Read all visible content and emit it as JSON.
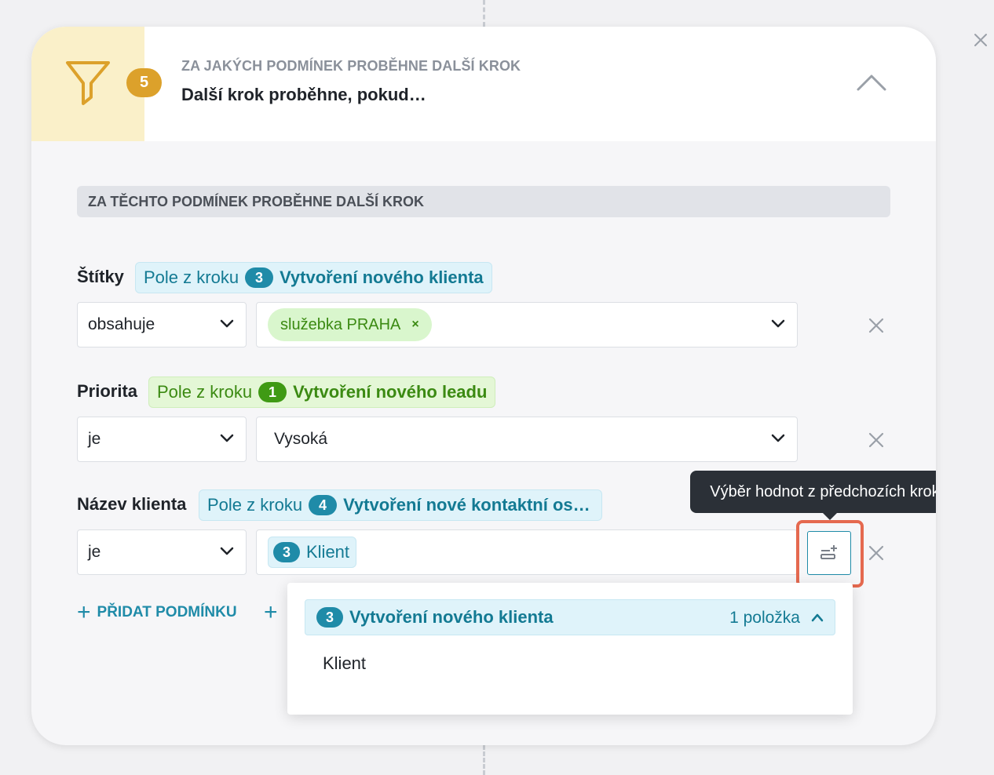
{
  "header": {
    "step_number": "5",
    "overline": "ZA JAKÝCH PODMÍNEK PROBĚHNE DALŠÍ KROK",
    "title": "Další krok proběhne, pokud…"
  },
  "section": {
    "title": "ZA TĚCHTO PODMÍNEK PROBĚHNE DALŠÍ KROK"
  },
  "conditions": [
    {
      "label": "Štítky",
      "field_prefix": "Pole z kroku",
      "step_number": "3",
      "step_name": "Vytvoření nového klienta",
      "operator": "obsahuje",
      "value_tag": "služebka PRAHA",
      "value_tag_remove": "×"
    },
    {
      "label": "Priorita",
      "field_prefix": "Pole z kroku",
      "step_number": "1",
      "step_name": "Vytvoření nového leadu",
      "operator": "je",
      "value": "Vysoká"
    },
    {
      "label": "Název klienta",
      "field_prefix": "Pole z kroku",
      "step_number": "4",
      "step_name": "Vytvoření nové kontaktní os…",
      "operator": "je",
      "value_step_number": "3",
      "value_field": "Klient"
    }
  ],
  "tooltip": "Výběr hodnot z předchozích kroků",
  "add_condition_label": "PŘIDAT PODMÍNKU",
  "add_icon": "+",
  "dropdown": {
    "group_step_number": "3",
    "group_title": "Vytvoření nového klienta",
    "group_count": "1 položka",
    "items": [
      "Klient"
    ]
  },
  "icons": {
    "step": "funnel-icon",
    "collapse": "chevron-up-icon",
    "remove": "close-icon",
    "picker": "insert-field-icon"
  },
  "colors": {
    "accent": "#1f8ba8",
    "step_badge": "#dca12b",
    "highlight": "#e5694f",
    "green": "#3b8a12"
  }
}
